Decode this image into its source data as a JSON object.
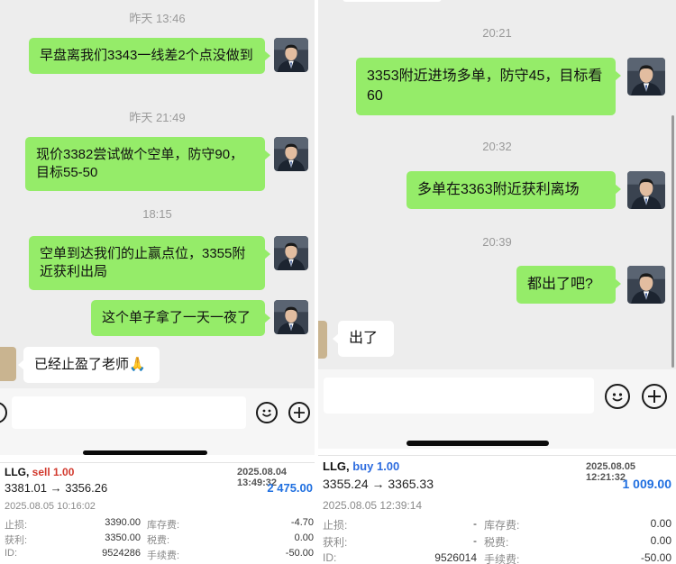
{
  "left": {
    "timestamps": [
      "昨天 13:46",
      "昨天 21:49",
      "18:15"
    ],
    "messages": [
      {
        "text": "早盘离我们3343一线差2个点没做到"
      },
      {
        "text": "现价3382尝试做个空单，防守90，目标55-50"
      },
      {
        "text": "空单到达我们的止赢点位，3355附近获利出局"
      },
      {
        "text": "这个单子拿了一天一夜了"
      }
    ],
    "reply": "已经止盈了老师🙏",
    "trade": {
      "symbol": "LLG,",
      "side": "sell 1.00",
      "open_time": "2025.08.04 13:49:32",
      "prices": "3381.01 → 3356.26",
      "profit": "2 475.00",
      "close_time": "2025.08.05 10:16:02",
      "rows": [
        {
          "label": "止损:",
          "value": "3390.00",
          "label2": "库存费:",
          "value2": "-4.70"
        },
        {
          "label": "获利:",
          "value": "3350.00",
          "label2": "税费:",
          "value2": "0.00"
        },
        {
          "label": "ID:",
          "value": "9524286",
          "label2": "手续费:",
          "value2": "-50.00"
        }
      ]
    }
  },
  "right": {
    "timestamps": [
      "20:21",
      "20:32",
      "20:39"
    ],
    "messages": [
      {
        "text": "3353附近进场多单，防守45，目标看60"
      },
      {
        "text": "多单在3363附近获利离场"
      },
      {
        "text": "都出了吧?"
      }
    ],
    "reply": "出了",
    "trade": {
      "symbol": "LLG,",
      "side": "buy 1.00",
      "open_time": "2025.08.05 12:21:32",
      "prices": "3355.24 → 3365.33",
      "profit": "1 009.00",
      "close_time": "2025.08.05 12:39:14",
      "rows": [
        {
          "label": "止损:",
          "value": "-",
          "label2": "库存费:",
          "value2": "0.00"
        },
        {
          "label": "获利:",
          "value": "-",
          "label2": "税费:",
          "value2": "0.00"
        },
        {
          "label": "ID:",
          "value": "9526014",
          "label2": "手续费:",
          "value2": "-50.00"
        }
      ]
    }
  },
  "icons": {
    "emoji": "emoji-icon",
    "plus": "plus-icon"
  },
  "colors": {
    "my_bubble": "#95ec69",
    "other_bubble": "#ffffff",
    "chat_bg": "#ededed",
    "sell": "#d23a2e",
    "buy": "#2d6cdf",
    "profit": "#1f6fe0"
  }
}
